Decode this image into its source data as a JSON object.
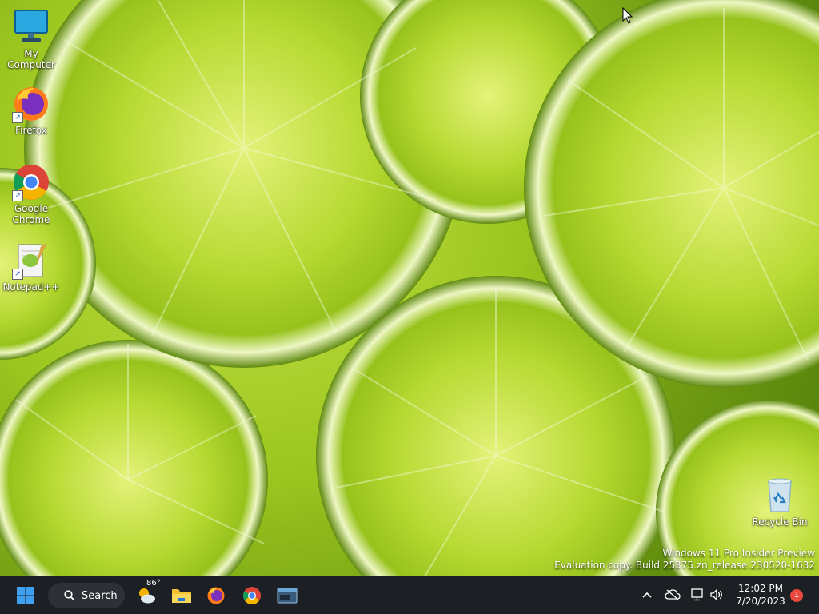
{
  "desktop": {
    "icons": [
      {
        "label": "My Computer",
        "icon": "computer-icon"
      },
      {
        "label": "Firefox",
        "icon": "firefox-icon"
      },
      {
        "label": "Google Chrome",
        "icon": "chrome-icon"
      },
      {
        "label": "Notepad++",
        "icon": "notepadpp-icon"
      },
      {
        "label": "Recycle Bin",
        "icon": "recycle-bin-icon"
      }
    ],
    "shortcut_glyph": "↗",
    "watermark": {
      "line1": "Windows 11 Pro Insider Preview",
      "line2": "Evaluation copy. Build 25375.zn_release.230520-1632"
    }
  },
  "taskbar": {
    "search_label": "Search",
    "weather_temp": "86°",
    "clock": {
      "time": "12:02 PM",
      "date": "7/20/2023"
    },
    "notification_count": "1"
  },
  "colors": {
    "taskbar_bg": "#1c1f24",
    "accent": "#0078d4",
    "badge": "#e8483d"
  }
}
